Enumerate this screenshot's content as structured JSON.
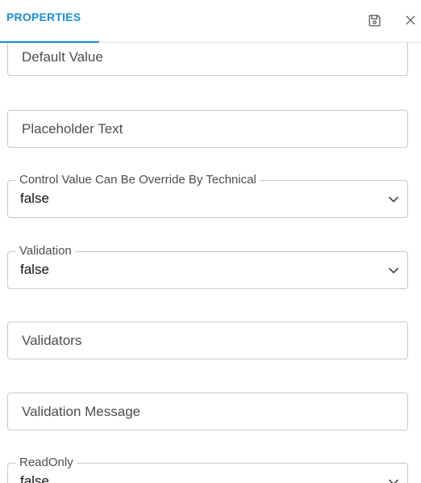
{
  "header": {
    "tab_label": "PROPERTIES",
    "save_icon": "save-icon",
    "close_icon": "close-icon"
  },
  "fields": {
    "default_value": {
      "placeholder": "Default Value"
    },
    "placeholder_text": {
      "placeholder": "Placeholder Text"
    },
    "control_override": {
      "label": "Control Value Can Be Override By Technical",
      "value": "false"
    },
    "validation": {
      "label": "Validation",
      "value": "false"
    },
    "validators": {
      "placeholder": "Validators"
    },
    "validation_message": {
      "placeholder": "Validation Message"
    },
    "readonly": {
      "label": "ReadOnly",
      "value": "false"
    }
  },
  "colors": {
    "accent": "#1a8fd1",
    "border": "#c8c8c8"
  }
}
